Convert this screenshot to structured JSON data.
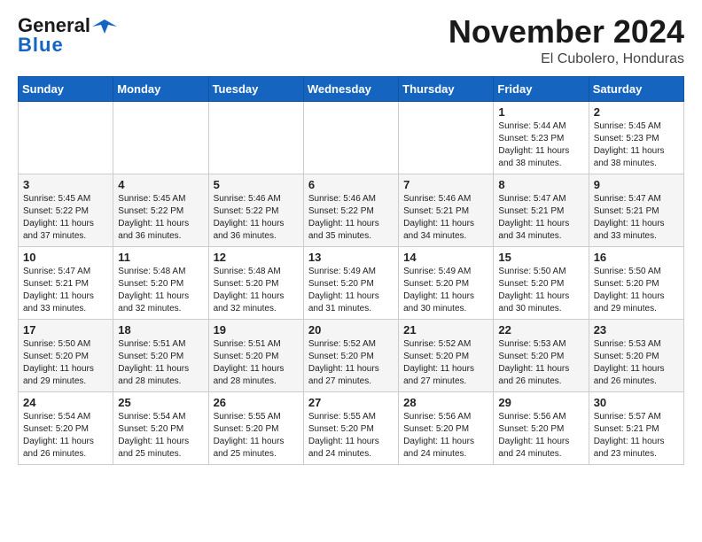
{
  "header": {
    "logo_general": "General",
    "logo_blue": "Blue",
    "month_title": "November 2024",
    "location": "El Cubolero, Honduras"
  },
  "weekdays": [
    "Sunday",
    "Monday",
    "Tuesday",
    "Wednesday",
    "Thursday",
    "Friday",
    "Saturday"
  ],
  "weeks": [
    [
      {
        "day": "",
        "info": ""
      },
      {
        "day": "",
        "info": ""
      },
      {
        "day": "",
        "info": ""
      },
      {
        "day": "",
        "info": ""
      },
      {
        "day": "",
        "info": ""
      },
      {
        "day": "1",
        "info": "Sunrise: 5:44 AM\nSunset: 5:23 PM\nDaylight: 11 hours\nand 38 minutes."
      },
      {
        "day": "2",
        "info": "Sunrise: 5:45 AM\nSunset: 5:23 PM\nDaylight: 11 hours\nand 38 minutes."
      }
    ],
    [
      {
        "day": "3",
        "info": "Sunrise: 5:45 AM\nSunset: 5:22 PM\nDaylight: 11 hours\nand 37 minutes."
      },
      {
        "day": "4",
        "info": "Sunrise: 5:45 AM\nSunset: 5:22 PM\nDaylight: 11 hours\nand 36 minutes."
      },
      {
        "day": "5",
        "info": "Sunrise: 5:46 AM\nSunset: 5:22 PM\nDaylight: 11 hours\nand 36 minutes."
      },
      {
        "day": "6",
        "info": "Sunrise: 5:46 AM\nSunset: 5:22 PM\nDaylight: 11 hours\nand 35 minutes."
      },
      {
        "day": "7",
        "info": "Sunrise: 5:46 AM\nSunset: 5:21 PM\nDaylight: 11 hours\nand 34 minutes."
      },
      {
        "day": "8",
        "info": "Sunrise: 5:47 AM\nSunset: 5:21 PM\nDaylight: 11 hours\nand 34 minutes."
      },
      {
        "day": "9",
        "info": "Sunrise: 5:47 AM\nSunset: 5:21 PM\nDaylight: 11 hours\nand 33 minutes."
      }
    ],
    [
      {
        "day": "10",
        "info": "Sunrise: 5:47 AM\nSunset: 5:21 PM\nDaylight: 11 hours\nand 33 minutes."
      },
      {
        "day": "11",
        "info": "Sunrise: 5:48 AM\nSunset: 5:20 PM\nDaylight: 11 hours\nand 32 minutes."
      },
      {
        "day": "12",
        "info": "Sunrise: 5:48 AM\nSunset: 5:20 PM\nDaylight: 11 hours\nand 32 minutes."
      },
      {
        "day": "13",
        "info": "Sunrise: 5:49 AM\nSunset: 5:20 PM\nDaylight: 11 hours\nand 31 minutes."
      },
      {
        "day": "14",
        "info": "Sunrise: 5:49 AM\nSunset: 5:20 PM\nDaylight: 11 hours\nand 30 minutes."
      },
      {
        "day": "15",
        "info": "Sunrise: 5:50 AM\nSunset: 5:20 PM\nDaylight: 11 hours\nand 30 minutes."
      },
      {
        "day": "16",
        "info": "Sunrise: 5:50 AM\nSunset: 5:20 PM\nDaylight: 11 hours\nand 29 minutes."
      }
    ],
    [
      {
        "day": "17",
        "info": "Sunrise: 5:50 AM\nSunset: 5:20 PM\nDaylight: 11 hours\nand 29 minutes."
      },
      {
        "day": "18",
        "info": "Sunrise: 5:51 AM\nSunset: 5:20 PM\nDaylight: 11 hours\nand 28 minutes."
      },
      {
        "day": "19",
        "info": "Sunrise: 5:51 AM\nSunset: 5:20 PM\nDaylight: 11 hours\nand 28 minutes."
      },
      {
        "day": "20",
        "info": "Sunrise: 5:52 AM\nSunset: 5:20 PM\nDaylight: 11 hours\nand 27 minutes."
      },
      {
        "day": "21",
        "info": "Sunrise: 5:52 AM\nSunset: 5:20 PM\nDaylight: 11 hours\nand 27 minutes."
      },
      {
        "day": "22",
        "info": "Sunrise: 5:53 AM\nSunset: 5:20 PM\nDaylight: 11 hours\nand 26 minutes."
      },
      {
        "day": "23",
        "info": "Sunrise: 5:53 AM\nSunset: 5:20 PM\nDaylight: 11 hours\nand 26 minutes."
      }
    ],
    [
      {
        "day": "24",
        "info": "Sunrise: 5:54 AM\nSunset: 5:20 PM\nDaylight: 11 hours\nand 26 minutes."
      },
      {
        "day": "25",
        "info": "Sunrise: 5:54 AM\nSunset: 5:20 PM\nDaylight: 11 hours\nand 25 minutes."
      },
      {
        "day": "26",
        "info": "Sunrise: 5:55 AM\nSunset: 5:20 PM\nDaylight: 11 hours\nand 25 minutes."
      },
      {
        "day": "27",
        "info": "Sunrise: 5:55 AM\nSunset: 5:20 PM\nDaylight: 11 hours\nand 24 minutes."
      },
      {
        "day": "28",
        "info": "Sunrise: 5:56 AM\nSunset: 5:20 PM\nDaylight: 11 hours\nand 24 minutes."
      },
      {
        "day": "29",
        "info": "Sunrise: 5:56 AM\nSunset: 5:20 PM\nDaylight: 11 hours\nand 24 minutes."
      },
      {
        "day": "30",
        "info": "Sunrise: 5:57 AM\nSunset: 5:21 PM\nDaylight: 11 hours\nand 23 minutes."
      }
    ]
  ]
}
